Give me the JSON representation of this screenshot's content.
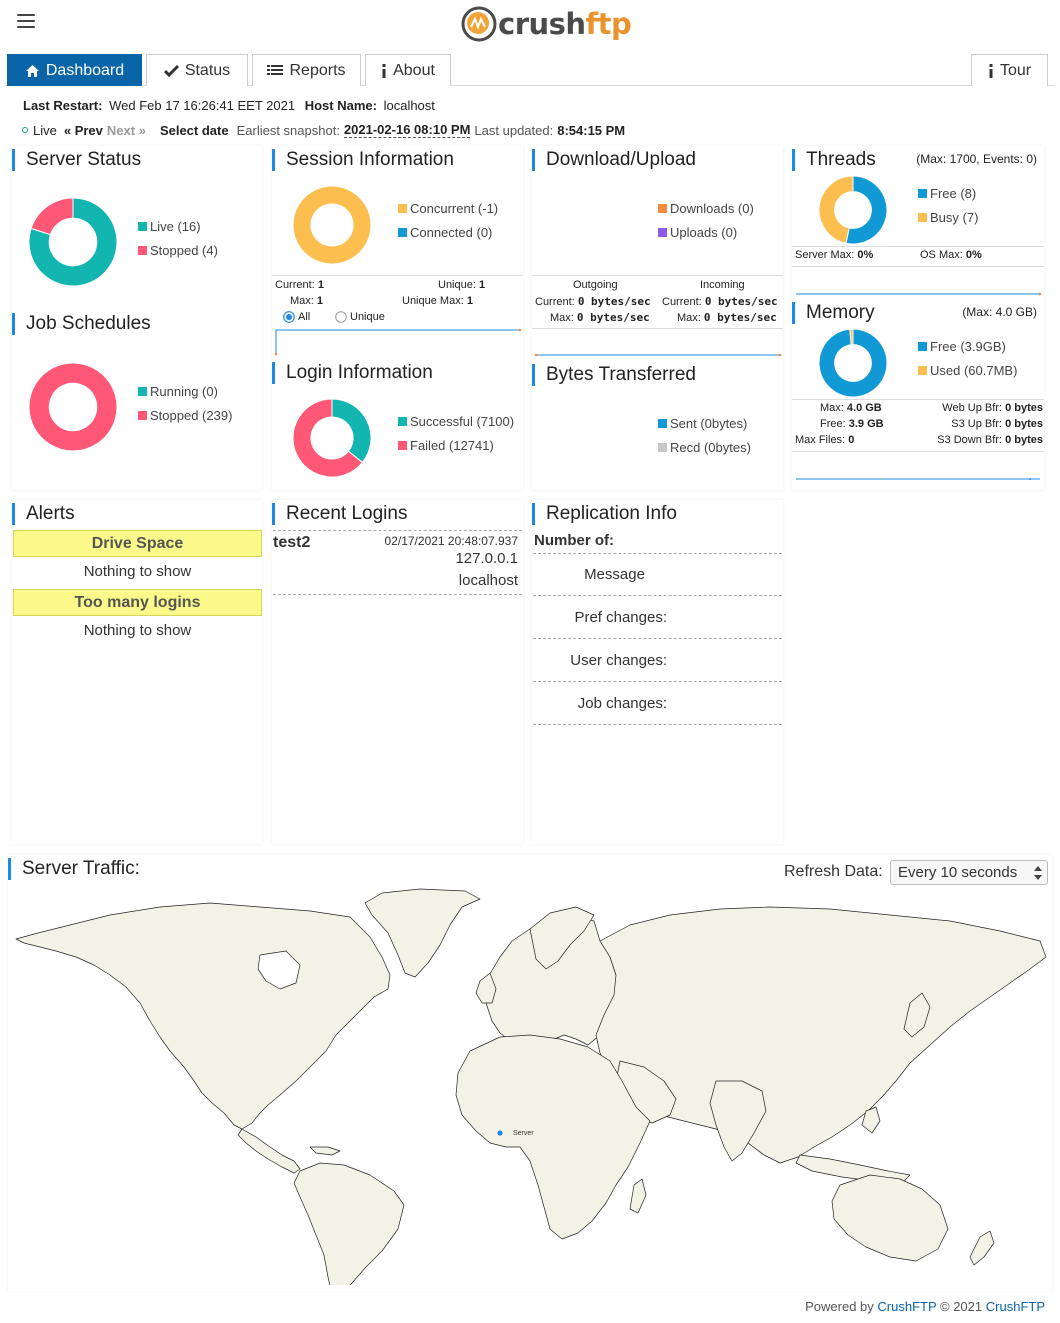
{
  "header": {
    "logo_part1": "crush",
    "logo_part2": "ftp"
  },
  "tabs": [
    {
      "label": "Dashboard",
      "icon": "home-icon"
    },
    {
      "label": "Status",
      "icon": "checkmark-icon"
    },
    {
      "label": "Reports",
      "icon": "list-icon"
    },
    {
      "label": "About",
      "icon": "info-icon"
    },
    {
      "label": "Tour",
      "icon": "info-icon"
    }
  ],
  "info": {
    "last_restart_label": "Last Restart:",
    "last_restart_value": "Wed Feb 17 16:26:41 EET 2021",
    "host_name_label": "Host Name:",
    "host_name_value": "localhost",
    "live": "Live",
    "prev": "« Prev",
    "next": "Next »",
    "select_date": "Select date",
    "earliest_label": "Earliest snapshot:",
    "earliest_value": "2021-02-16 08:10 PM",
    "last_updated_label": "Last updated:",
    "last_updated_value": "8:54:15 PM"
  },
  "server_status": {
    "title": "Server Status",
    "legend": [
      {
        "label": "Live (16)",
        "value": 16,
        "color": "#12b5b0"
      },
      {
        "label": "Stopped (4)",
        "value": 4,
        "color": "#ff5776"
      }
    ]
  },
  "job_schedules": {
    "title": "Job Schedules",
    "legend": [
      {
        "label": "Running (0)",
        "value": 0,
        "color": "#12b5b0"
      },
      {
        "label": "Stopped (239)",
        "value": 239,
        "color": "#ff5776"
      }
    ]
  },
  "session_info": {
    "title": "Session Information",
    "legend": [
      {
        "label": "Concurrent (-1)",
        "value": 1,
        "color": "#fdbe50"
      },
      {
        "label": "Connected (0)",
        "value": 0,
        "color": "#1199d6"
      }
    ],
    "current_label": "Current:",
    "current_value": "1",
    "max_label": "Max:",
    "max_value": "1",
    "unique_label": "Unique:",
    "unique_value": "1",
    "unique_max_label": "Unique Max:",
    "unique_max_value": "1",
    "radio_all": "All",
    "radio_unique": "Unique"
  },
  "login_info": {
    "title": "Login Information",
    "legend": [
      {
        "label": "Successful (7100)",
        "value": 7100,
        "color": "#12b5b0"
      },
      {
        "label": "Failed (12741)",
        "value": 12741,
        "color": "#ff5776"
      }
    ]
  },
  "download_upload": {
    "title": "Download/Upload",
    "legend": [
      {
        "label": "Downloads (0)",
        "color": "#f28d3a"
      },
      {
        "label": "Uploads (0)",
        "color": "#8c5ce8"
      }
    ],
    "outgoing": "Outgoing",
    "incoming": "Incoming",
    "current_label": "Current:",
    "max_label": "Max:",
    "out_current": "0 bytes/sec",
    "out_max": "0 bytes/sec",
    "in_current": "0 bytes/sec",
    "in_max": "0 bytes/sec"
  },
  "bytes_transferred": {
    "title": "Bytes Transferred",
    "legend": [
      {
        "label": "Sent (0bytes)",
        "color": "#1199d6"
      },
      {
        "label": "Recd (0bytes)",
        "color": "#c8c8c8"
      }
    ]
  },
  "threads": {
    "title": "Threads",
    "subtitle": "(Max: 1700, Events: 0)",
    "legend": [
      {
        "label": "Free (8)",
        "value": 8,
        "color": "#1199d6"
      },
      {
        "label": "Busy (7)",
        "value": 7,
        "color": "#fdbe50"
      }
    ],
    "server_max_label": "Server Max:",
    "server_max_value": "0%",
    "os_max_label": "OS Max:",
    "os_max_value": "0%"
  },
  "memory": {
    "title": "Memory",
    "subtitle": "(Max: 4.0 GB)",
    "legend": [
      {
        "label": "Free (3.9GB)",
        "value": 3.9,
        "color": "#1199d6"
      },
      {
        "label": "Used (60.7MB)",
        "value": 0.06,
        "color": "#fdbe50"
      }
    ],
    "max_label": "Max:",
    "max_value": "4.0 GB",
    "free_label": "Free:",
    "free_value": "3.9 GB",
    "max_files_label": "Max Files:",
    "max_files_value": "0",
    "web_up_label": "Web Up Bfr:",
    "web_up_value": "0 bytes",
    "s3_up_label": "S3 Up Bfr:",
    "s3_up_value": "0 bytes",
    "s3_down_label": "S3 Down Bfr:",
    "s3_down_value": "0 bytes"
  },
  "alerts": {
    "title": "Alerts",
    "groups": [
      {
        "header": "Drive Space",
        "body": "Nothing to show"
      },
      {
        "header": "Too many logins",
        "body": "Nothing to show"
      }
    ]
  },
  "recent_logins": {
    "title": "Recent Logins",
    "items": [
      {
        "user": "test2",
        "time": "02/17/2021 20:48:07.937",
        "ip": "127.0.0.1",
        "host": "localhost"
      }
    ]
  },
  "replication": {
    "title": "Replication Info",
    "number_of": "Number of:",
    "rows": [
      "Message",
      "Pref changes:",
      "User changes:",
      "Job changes:"
    ]
  },
  "server_traffic": {
    "title": "Server Traffic:",
    "refresh_label": "Refresh Data:",
    "refresh_value": "Every 10 seconds",
    "marker_label": "Server"
  },
  "footer": {
    "powered_by": "Powered by",
    "link1": "CrushFTP",
    "copyright": "© 2021",
    "link2": "CrushFTP"
  }
}
